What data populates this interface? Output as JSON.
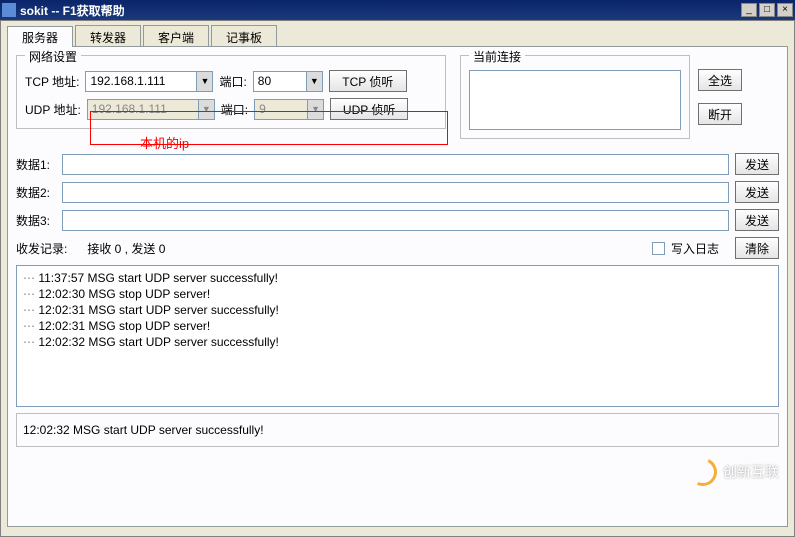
{
  "window": {
    "title": "sokit -- F1获取帮助"
  },
  "tabs": {
    "labels": [
      "服务器",
      "转发器",
      "客户端",
      "记事板"
    ],
    "active": 0
  },
  "group_net": {
    "title": "网络设置"
  },
  "tcp": {
    "addr_label": "TCP 地址:",
    "addr": "192.168.1.111",
    "port_label": "端口:",
    "port": "80",
    "button": "TCP 侦听"
  },
  "udp": {
    "addr_label": "UDP 地址:",
    "addr": "192.168.1.111",
    "port_label": "端口:",
    "port": "9",
    "button": "UDP 侦听"
  },
  "group_conn": {
    "title": "当前连接"
  },
  "buttons": {
    "select_all": "全选",
    "disconnect": "断开",
    "send": "发送",
    "clear": "清除"
  },
  "data_rows": {
    "label1": "数据1:",
    "label2": "数据2:",
    "label3": "数据3:",
    "v1": "",
    "v2": "",
    "v3": ""
  },
  "stats": {
    "label": "收发记录:",
    "text": "接收 0 , 发送 0"
  },
  "log_checkbox": {
    "label": "写入日志",
    "checked": false
  },
  "log": [
    "11:37:57 MSG start UDP server successfully!",
    "12:02:30 MSG stop UDP server!",
    "12:02:31 MSG start UDP server successfully!",
    "12:02:31 MSG stop UDP server!",
    "12:02:32 MSG start UDP server successfully!"
  ],
  "status": {
    "text": "12:02:32 MSG start UDP server successfully!"
  },
  "annotation": {
    "text": "本机的ip"
  },
  "watermark": {
    "text": "创新互联"
  }
}
